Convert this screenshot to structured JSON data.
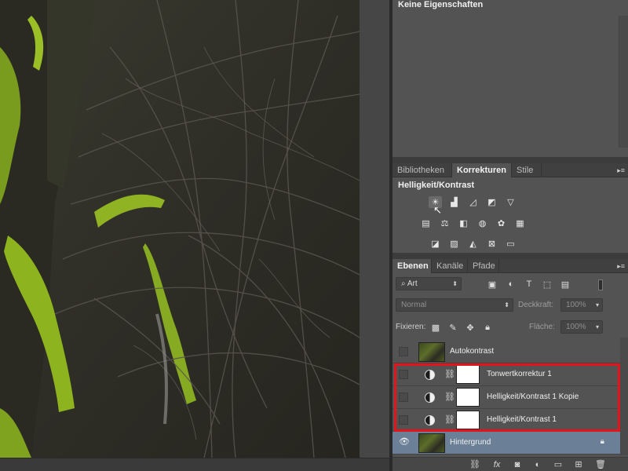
{
  "properties": {
    "title": "Keine Eigenschaften"
  },
  "corrections_panel": {
    "tabs": [
      {
        "label": "Bibliotheken",
        "active": false
      },
      {
        "label": "Korrekturen",
        "active": true
      },
      {
        "label": "Stile",
        "active": false
      }
    ],
    "heading": "Helligkeit/Kontrast",
    "icon_rows": [
      [
        "brightness-contrast-icon",
        "levels-icon",
        "curves-icon",
        "exposure-icon",
        "vibrance-icon"
      ],
      [
        "hue-saturation-icon",
        "color-balance-icon",
        "black-white-icon",
        "photo-filter-icon",
        "channel-mixer-icon",
        "color-lookup-icon"
      ],
      [
        "invert-icon",
        "posterize-icon",
        "threshold-icon",
        "selective-color-icon",
        "gradient-map-icon"
      ]
    ]
  },
  "layers_panel": {
    "tabs": [
      {
        "label": "Ebenen",
        "active": true
      },
      {
        "label": "Kanäle",
        "active": false
      },
      {
        "label": "Pfade",
        "active": false
      }
    ],
    "filter_kind": "Art",
    "blend_mode": "Normal",
    "opacity_label": "Deckkraft:",
    "opacity_value": "100%",
    "lock_label": "Fixieren:",
    "fill_label": "Fläche:",
    "fill_value": "100%",
    "layers": [
      {
        "name": "Autokontrast",
        "visible": false,
        "type": "pixel"
      },
      {
        "name": "Tonwertkorrektur 1",
        "visible": false,
        "type": "adjustment"
      },
      {
        "name": "Helligkeit/Kontrast 1 Kopie",
        "visible": false,
        "type": "adjustment"
      },
      {
        "name": "Helligkeit/Kontrast 1",
        "visible": false,
        "type": "adjustment"
      },
      {
        "name": "Hintergrund",
        "visible": true,
        "type": "background",
        "selected": true,
        "locked": true
      }
    ]
  },
  "colors": {
    "highlight": "#e3151a",
    "selected_layer": "#6b7f97"
  }
}
